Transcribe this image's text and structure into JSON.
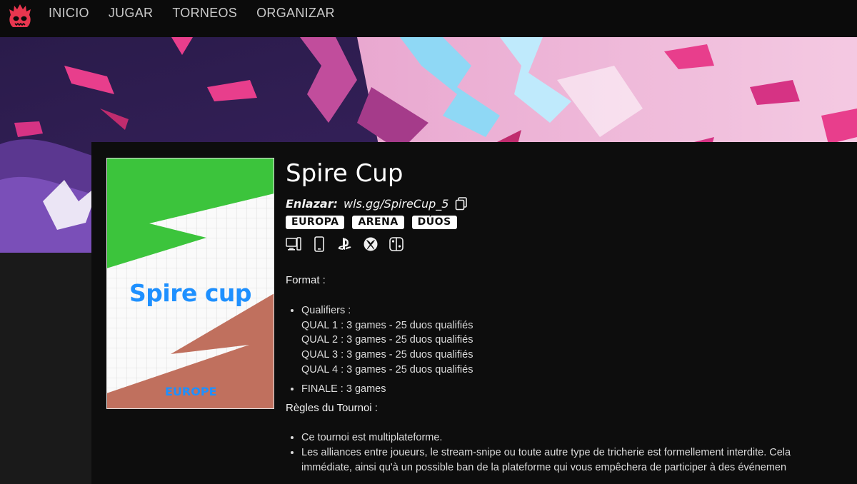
{
  "nav": {
    "logo_icon": "demon-logo-icon",
    "links": [
      "INICIO",
      "JUGAR",
      "TORNEOS",
      "ORGANIZAR"
    ]
  },
  "colors": {
    "nav_bg": "#0b0b0b",
    "panel_bg": "#0d0d0d",
    "accent_pink": "#e83e8c",
    "accent_purple": "#5b2a86",
    "logo_red": "#e8364f"
  },
  "tournament": {
    "title": "Spire Cup",
    "link_label": "Enlazar:",
    "link_value": "wls.gg/SpireCup_5",
    "tags": [
      "EUROPA",
      "ARENA",
      "DÚOS"
    ],
    "platform_icons": [
      "pc-console-icon",
      "mobile-icon",
      "playstation-icon",
      "xbox-icon",
      "switch-icon"
    ],
    "cover": {
      "title": "Spire cup",
      "region": "EUROPE"
    }
  },
  "description": {
    "format_heading": "Format :",
    "qualifiers_label": "Qualifiers :",
    "quals": [
      "QUAL 1 : 3 games - 25 duos qualifiés",
      "QUAL 2 : 3 games - 25 duos qualifiés",
      "QUAL 3 : 3 games - 25 duos qualifiés",
      "QUAL 4 : 3 games - 25 duos qualifiés"
    ],
    "finale": "FINALE : 3 games",
    "rules_heading": "Règles du Tournoi :",
    "rules": [
      "Ce tournoi est multiplateforme.",
      "Les alliances entre joueurs, le stream-snipe ou toute autre type de tricherie est formellement interdite. Cela",
      "immédiate, ainsi qu'à un possible ban de la plateforme qui vous empêchera de participer à des événemen"
    ]
  }
}
